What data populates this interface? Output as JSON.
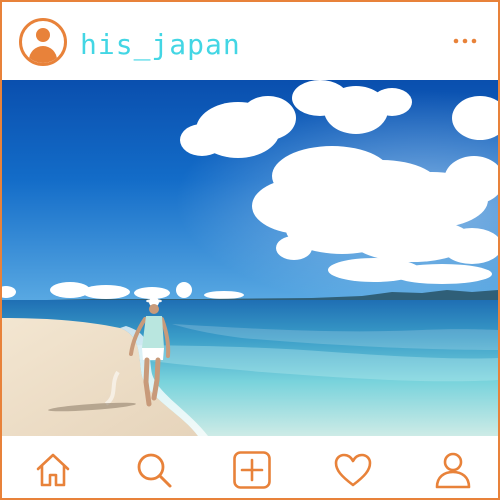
{
  "profile": {
    "username": "his_japan",
    "avatar_icon": "user-avatar-icon"
  },
  "header": {
    "menu_icon": "more-horizontal-icon"
  },
  "post": {
    "image_subject": "beach-photo"
  },
  "nav": {
    "items": [
      {
        "icon": "home-icon"
      },
      {
        "icon": "search-icon"
      },
      {
        "icon": "add-post-icon"
      },
      {
        "icon": "heart-icon"
      },
      {
        "icon": "profile-icon"
      }
    ]
  },
  "colors": {
    "accent": "#e8823a",
    "username": "#43d6e4",
    "sky": "#0f5fb8",
    "sea": "#52b6cf",
    "sand": "#f1e4d0"
  }
}
